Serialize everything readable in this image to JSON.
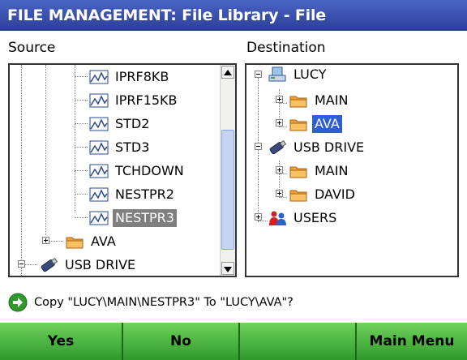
{
  "window": {
    "title": "FILE MANAGEMENT: File Library - File"
  },
  "source": {
    "label": "Source",
    "items": [
      {
        "label": "IPRF8KB",
        "icon": "waveform-file-icon"
      },
      {
        "label": "IPRF15KB",
        "icon": "waveform-file-icon"
      },
      {
        "label": "STD2",
        "icon": "waveform-file-icon"
      },
      {
        "label": "STD3",
        "icon": "waveform-file-icon"
      },
      {
        "label": "TCHDOWN",
        "icon": "waveform-file-icon"
      },
      {
        "label": "NESTPR2",
        "icon": "waveform-file-icon"
      },
      {
        "label": "NESTPR3",
        "icon": "waveform-file-icon",
        "selected": true
      },
      {
        "label": "AVA",
        "icon": "folder-icon",
        "expander": "+"
      },
      {
        "label": "USB DRIVE",
        "icon": "usb-drive-icon",
        "expander": "-"
      }
    ]
  },
  "destination": {
    "label": "Destination",
    "items": [
      {
        "label": "LUCY",
        "icon": "network-computer-icon",
        "expander": "-"
      },
      {
        "label": "MAIN",
        "icon": "folder-icon",
        "expander": "+"
      },
      {
        "label": "AVA",
        "icon": "folder-icon",
        "expander": "+",
        "selected": true
      },
      {
        "label": "USB DRIVE",
        "icon": "usb-drive-icon",
        "expander": "-"
      },
      {
        "label": "MAIN",
        "icon": "folder-icon",
        "expander": "+"
      },
      {
        "label": "DAVID",
        "icon": "folder-icon",
        "expander": "+"
      },
      {
        "label": "USERS",
        "icon": "users-icon",
        "expander": "+"
      }
    ]
  },
  "prompt": {
    "text": "Copy \"LUCY\\MAIN\\NESTPR3\" To \"LUCY\\AVA\"?",
    "icon": "arrow-right-circle-icon"
  },
  "footer": {
    "buttons": [
      {
        "label": "Yes"
      },
      {
        "label": "No"
      },
      {
        "label": ""
      },
      {
        "label": "Main Menu"
      }
    ]
  },
  "colors": {
    "title_bar": "#2c3f98",
    "selection_blue": "#2d5fd0",
    "selection_gray": "#7f7f7f",
    "footer_green": "#3fae35",
    "folder": "#f0a23a"
  }
}
